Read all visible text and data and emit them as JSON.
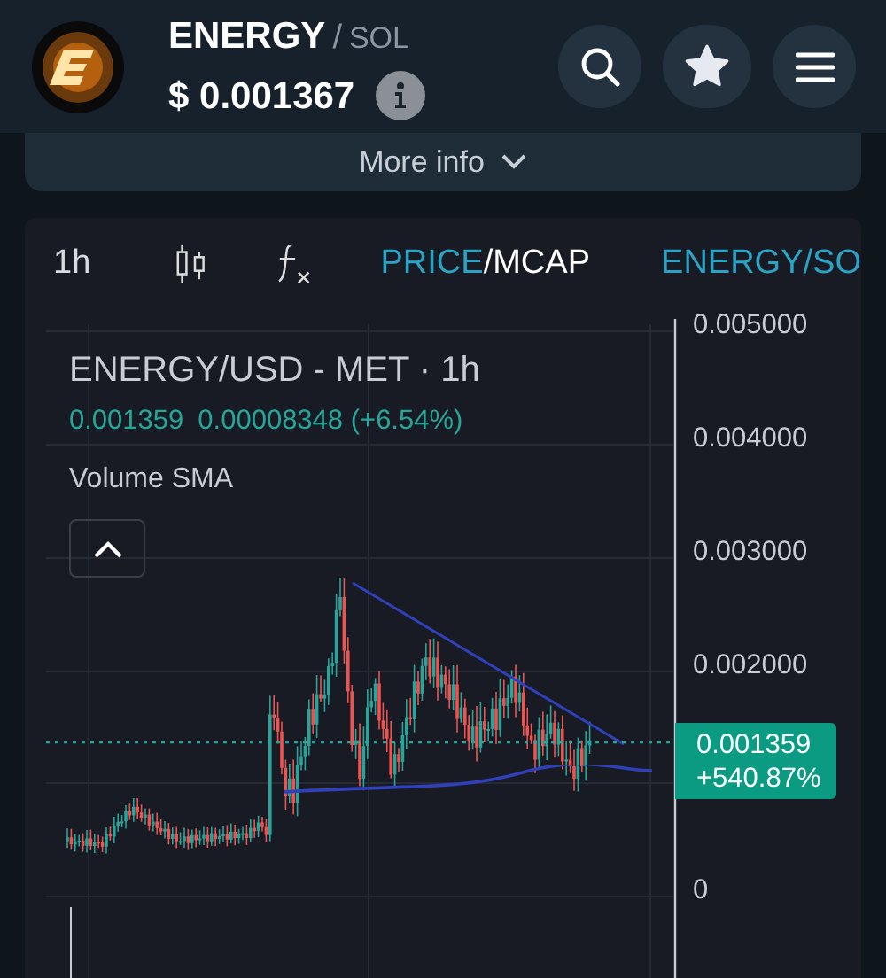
{
  "header": {
    "symbol": "ENERGY",
    "separator": "/",
    "quote": "SOL",
    "price": "$ 0.001367"
  },
  "more_info": {
    "label": "More info"
  },
  "toolbar": {
    "interval": "1h",
    "price_mode": [
      {
        "label": "PRICE",
        "selected": true
      },
      {
        "label": "MCAP",
        "selected": false
      }
    ],
    "mode_separator": "/",
    "pair": "ENERGY/SO"
  },
  "chart": {
    "title": "ENERGY/USD - MET · 1h",
    "last": "0.001359",
    "change": "0.00008348 (+6.54%)",
    "indicator": "Volume SMA",
    "y_axis_labels": [
      "0.005000",
      "0.004000",
      "0.003000",
      "0.002000",
      "0"
    ],
    "price_badge": {
      "price": "0.001359",
      "change": "+540.87%"
    }
  }
}
